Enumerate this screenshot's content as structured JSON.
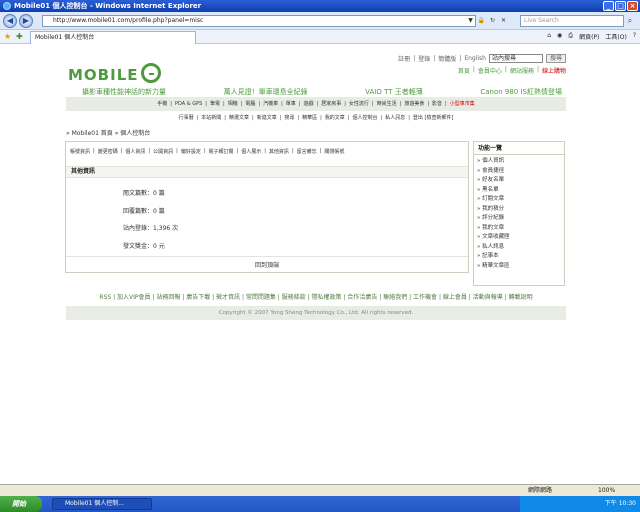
{
  "window": {
    "title": "Mobile01 個人控制台 - Windows Internet Explorer"
  },
  "browser": {
    "address": "http://www.mobile01.com/profile.php?panel=misc",
    "search_placeholder": "Live Search",
    "tab_title": "Mobile01 個人控制台",
    "cmds": [
      "網頁(P)",
      "工具(O)",
      "?"
    ]
  },
  "site": {
    "logo": "MOBILE",
    "toplinks": [
      "註冊",
      "登錄",
      "簡體版",
      "English"
    ],
    "search_value": "站內搜尋",
    "search_button": "搜尋",
    "toplinks2": [
      "首頁",
      "會員中心",
      "網站服務",
      "線上購物"
    ],
    "promos": [
      "攝影車種性能神話的新力量",
      "萬人見證！單車環島全紀錄",
      "VAIO TT 王者輕薄",
      "Canon 980 IS紅熱情登場"
    ],
    "mainnav": [
      "手機",
      "PDA & GPS",
      "筆電",
      "相機",
      "電腦",
      "汽機車",
      "單車",
      "遊戲",
      "居家房事",
      "女性流行",
      "時尚生活",
      "旅遊美食",
      "影音"
    ],
    "mainnav_hot": "小型車市集",
    "subnav": [
      "行事曆",
      "本站新聞",
      "精選文章",
      "新進文章",
      "搜尋",
      "精華區",
      "我的文章",
      "個人控制台",
      "私人訊息",
      "登出 [檢查新郵件]"
    ],
    "breadcrumb": "» Mobile01 首頁 » 個人控制台",
    "tabs": [
      "帳號資訊",
      "變更密碼",
      "個人資訊",
      "公開資訊",
      "偏好設定",
      "電子報訂閱",
      "個人展示",
      "其他資訊",
      "留言備忘",
      "關閉帳號"
    ],
    "section_title": "其他資訊",
    "stats": [
      "閱文篇數：0 篇",
      "回覆篇數：0 篇",
      "站內登錄：1,396 次",
      "發文獎金：0 元"
    ],
    "return_link": "回到頂端",
    "side_title": "功能一覽",
    "side_items": [
      "» 個人資訊",
      "» 會員捷徑",
      "» 好友名單",
      "» 黑名單",
      "» 訂閱文章",
      "» 我的積分",
      "» 評分紀錄",
      "» 我的文章",
      "» 文章收藏匣",
      "» 私人訊息",
      "» 記事本",
      "» 精華文章區"
    ],
    "footer_links": "RSS | 加入VIP會員 | 站務回報 | 廣告下載 | 徵才資訊 | 常問問題集 | 服務條款 | 隱私權政策 | 合作洽廣告 | 聯絡我們 | 工作機會 | 線上會員 | 活動與報導 | 轉載說明",
    "copyright": "Copyright © 2007 Yong Sheng Technology Co., Ltd. All rights reserved."
  },
  "status": {
    "zone": "網際網路",
    "zoom": "100%"
  },
  "taskbar": {
    "start": "開始",
    "item": "Mobile01 個人控制...",
    "time": "下午 10:30"
  }
}
